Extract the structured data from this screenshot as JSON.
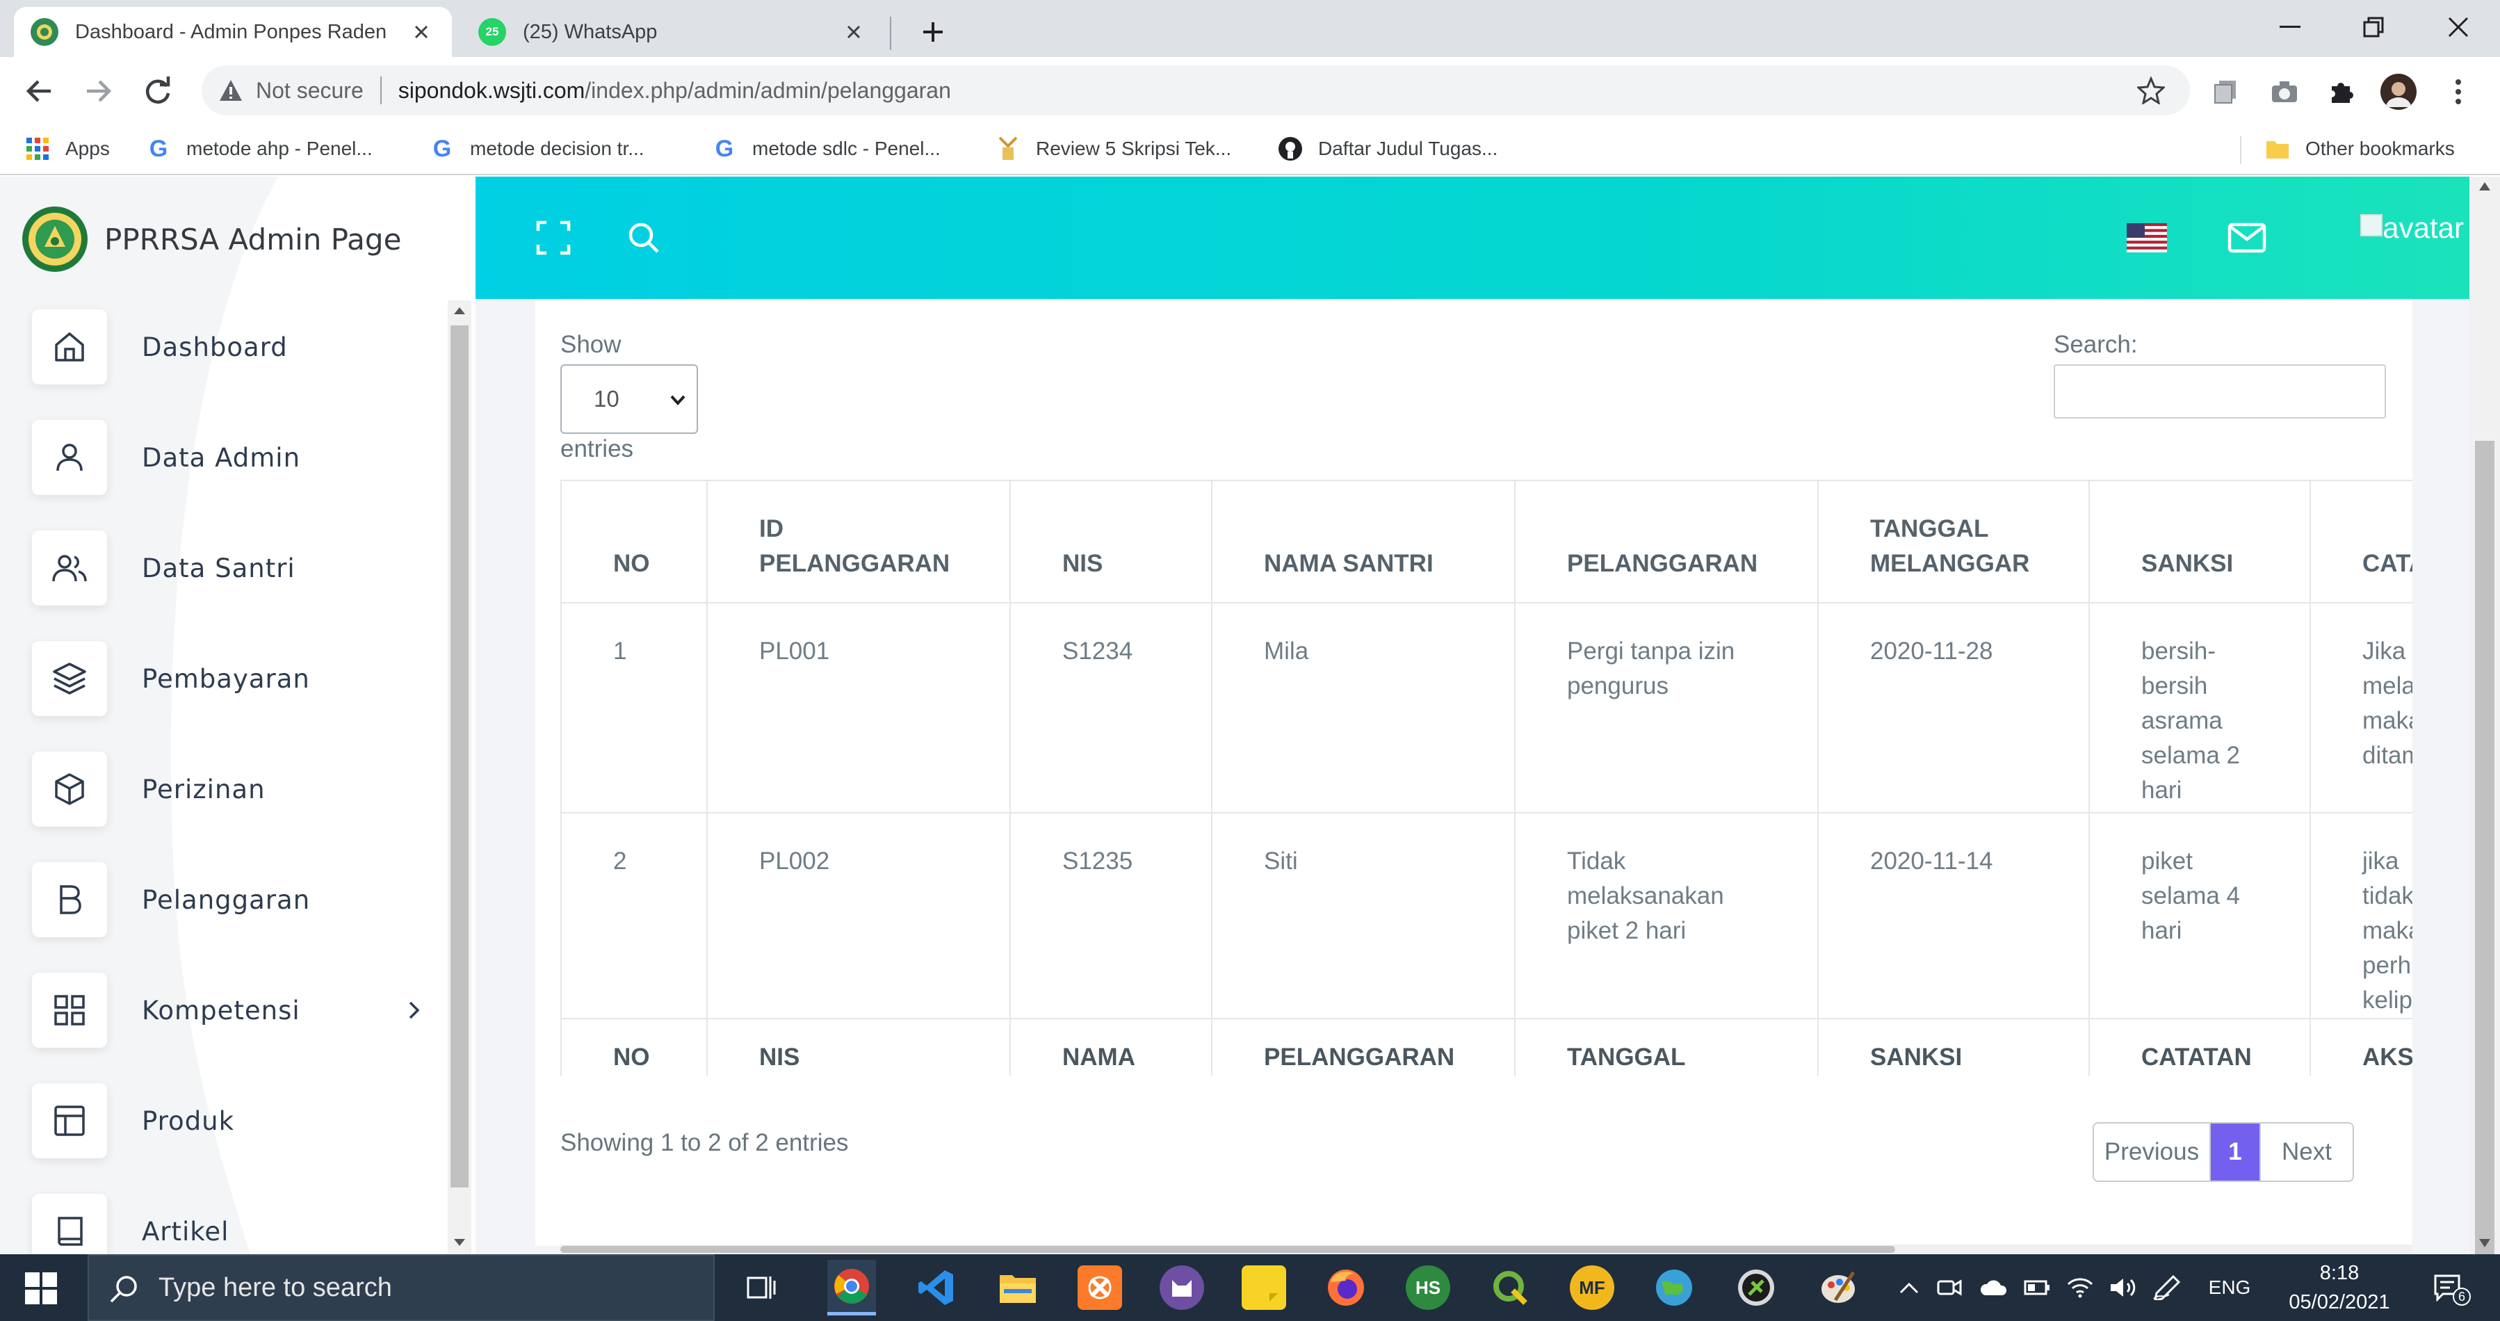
{
  "browser": {
    "tabs": [
      {
        "title": "Dashboard - Admin Ponpes Raden",
        "active": true
      },
      {
        "title": "(25) WhatsApp",
        "active": false,
        "badge": "25"
      }
    ],
    "security_label": "Not secure",
    "url_host": "sipondok.wsjti.com",
    "url_path": "/index.php/admin/admin/pelanggaran",
    "bookmarks": [
      {
        "label": "Apps",
        "icon": "apps-grid-icon"
      },
      {
        "label": "metode ahp - Penel...",
        "icon": "google-icon"
      },
      {
        "label": "metode decision tr...",
        "icon": "google-icon"
      },
      {
        "label": "metode sdlc - Penel...",
        "icon": "google-icon"
      },
      {
        "label": "Review 5 Skripsi Tek...",
        "icon": "page-icon"
      },
      {
        "label": "Daftar Judul Tugas...",
        "icon": "github-icon"
      }
    ],
    "other_bookmarks": "Other bookmarks"
  },
  "sidebar": {
    "brand": "PPRRSA Admin Page",
    "items": [
      {
        "label": "Dashboard",
        "icon": "home-icon"
      },
      {
        "label": "Data Admin",
        "icon": "user-icon"
      },
      {
        "label": "Data Santri",
        "icon": "users-icon"
      },
      {
        "label": "Pembayaran",
        "icon": "layers-icon"
      },
      {
        "label": "Perizinan",
        "icon": "box-icon"
      },
      {
        "label": "Pelanggaran",
        "icon": "letter-b-icon"
      },
      {
        "label": "Kompetensi",
        "icon": "grid-icon",
        "has_submenu": true
      },
      {
        "label": "Produk",
        "icon": "layout-icon"
      },
      {
        "label": "Artikel",
        "icon": "book-icon"
      }
    ]
  },
  "header": {
    "avatar_alt": "avatar",
    "icons": [
      "fullscreen-icon",
      "search-icon",
      "us-flag-icon",
      "mail-icon"
    ]
  },
  "controls": {
    "show_label": "Show",
    "page_length": "10",
    "entries_label": "entries",
    "search_label": "Search:",
    "search_value": ""
  },
  "table": {
    "columns": [
      "NO",
      "ID PELANGGARAN",
      "NIS",
      "NAMA SANTRI",
      "PELANGGARAN",
      "TANGGAL MELANGGAR",
      "SANKSI",
      "CATATAN"
    ],
    "rows": [
      [
        "1",
        "PL001",
        "S1234",
        "Mila",
        "Pergi tanpa izin pengurus",
        "2020-11-28",
        "bersih-bersih asrama selama 2 hari",
        "Jika melanggar maka ditambah"
      ],
      [
        "2",
        "PL002",
        "S1235",
        "Siti",
        "Tidak melaksanakan piket 2 hari",
        "2020-11-14",
        "piket selama 4 hari",
        "jika tidak maka perhitungan kelipatan"
      ]
    ],
    "footer_columns": [
      "NO",
      "NIS",
      "NAMA SANTRI",
      "PELANGGARAN",
      "TANGGAL MELANGGAR",
      "SANKSI",
      "CATATAN",
      "AKSI"
    ]
  },
  "pagination": {
    "info": "Showing 1 to 2 of 2 entries",
    "previous": "Previous",
    "current": "1",
    "next": "Next"
  },
  "taskbar": {
    "search_placeholder": "Type here to search",
    "language": "ENG",
    "time": "8:18",
    "date": "05/02/2021",
    "notifications": "6",
    "apps": [
      "task-view-icon",
      "chrome-icon",
      "vscode-icon",
      "file-explorer-icon",
      "xampp-icon",
      "app-cat-icon",
      "sticky-notes-icon",
      "firefox-icon",
      "hs-icon",
      "qgis-icon",
      "mf-icon",
      "globe-icon",
      "shield-app-icon",
      "paint-icon"
    ]
  },
  "colors": {
    "header_gradient_start": "#00d0e3",
    "header_gradient_end": "#1ae3bc",
    "pager_active": "#7460ee",
    "taskbar": "#1f2d3d"
  }
}
